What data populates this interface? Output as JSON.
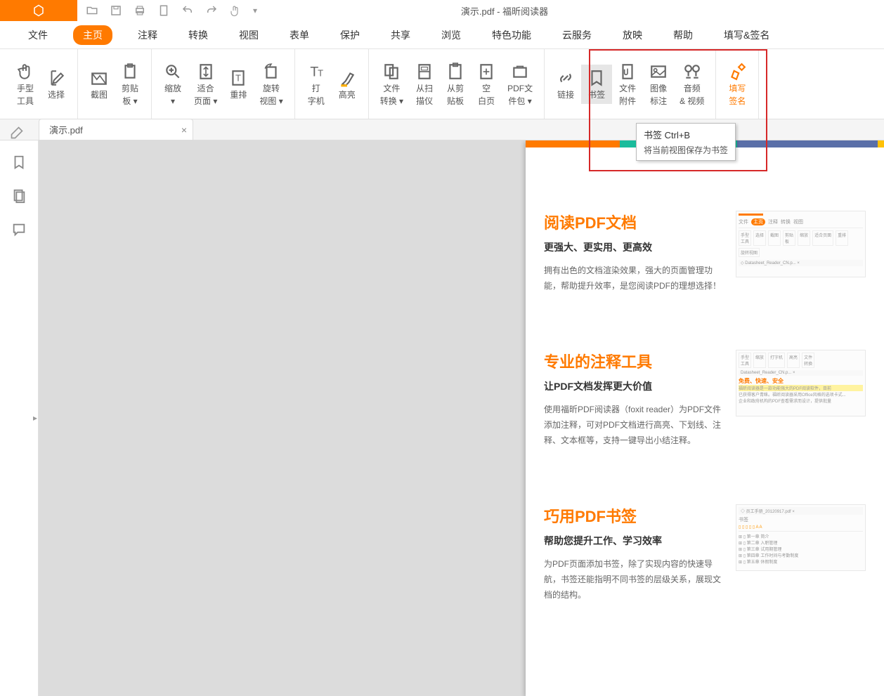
{
  "title": "演示.pdf - 福昕阅读器",
  "qat": {
    "logo": "foxit-logo"
  },
  "menus": [
    "文件",
    "主页",
    "注释",
    "转换",
    "视图",
    "表单",
    "保护",
    "共享",
    "浏览",
    "特色功能",
    "云服务",
    "放映",
    "帮助",
    "填写&签名"
  ],
  "active_menu": 1,
  "ribbon": {
    "groups": [
      [
        {
          "label": "手型\n工具",
          "icon": "hand"
        },
        {
          "label": "选择",
          "icon": "select-text"
        }
      ],
      [
        {
          "label": "截图",
          "icon": "snapshot"
        },
        {
          "label": "剪贴\n板 ▾",
          "icon": "clipboard"
        }
      ],
      [
        {
          "label": "缩放\n▾",
          "icon": "zoom"
        },
        {
          "label": "适合\n页面 ▾",
          "icon": "fit-page"
        },
        {
          "label": "重排",
          "icon": "reflow"
        },
        {
          "label": "旋转\n视图 ▾",
          "icon": "rotate"
        }
      ],
      [
        {
          "label": "打\n字机",
          "icon": "typewriter"
        },
        {
          "label": "高亮",
          "icon": "highlight"
        }
      ],
      [
        {
          "label": "文件\n转换 ▾",
          "icon": "file-convert"
        },
        {
          "label": "从扫\n描仪",
          "icon": "scanner"
        },
        {
          "label": "从剪\n贴板",
          "icon": "from-clip"
        },
        {
          "label": "空\n白页",
          "icon": "blank"
        },
        {
          "label": "PDF文\n件包 ▾",
          "icon": "portfolio"
        }
      ],
      [
        {
          "label": "链接",
          "icon": "link"
        },
        {
          "label": "书签",
          "icon": "bookmark",
          "hl": true
        },
        {
          "label": "文件\n附件",
          "icon": "attachment"
        },
        {
          "label": "图像\n标注",
          "icon": "image-anno"
        },
        {
          "label": "音频\n& 视频",
          "icon": "av"
        }
      ],
      [
        {
          "label": "填写\n签名",
          "icon": "fill-sign",
          "accent": true
        }
      ]
    ]
  },
  "tooltip": {
    "title": "书签     Ctrl+B",
    "body": "将当前视图保存为书签"
  },
  "tab": {
    "name": "演示.pdf"
  },
  "left_icons": [
    "bookmark-panel",
    "pages-panel",
    "comments-panel"
  ],
  "pdf": {
    "sections": [
      {
        "title": "阅读PDF文档",
        "sub": "更强大、更实用、更高效",
        "body": "拥有出色的文档渲染效果，强大的页面管理功能，帮助提升效率，是您阅读PDF的理想选择！",
        "thumb": "thumb-read"
      },
      {
        "title": "专业的注释工具",
        "sub": "让PDF文档发挥更大价值",
        "body": "使用福昕PDF阅读器（foxit reader）为PDF文件添加注释，可对PDF文档进行高亮、下划线、注释、文本框等，支持一键导出小结注释。",
        "thumb": "thumb-annotate"
      },
      {
        "title": "巧用PDF书签",
        "sub": "帮助您提升工作、学习效率",
        "body": "为PDF页面添加书签，除了实现内容的快速导航，书签还能指明不同书签的层级关系，展现文档的结构。",
        "thumb": "thumb-bookmark"
      }
    ],
    "thumb1": {
      "tab": "Datasheet_Reader_CN.p...",
      "menus": [
        "文件",
        "主页",
        "注释",
        "转换",
        "视图"
      ],
      "btns": [
        "手型\n工具",
        "选择",
        "截图",
        "剪贴\n板",
        "缩放",
        "适合页面",
        "重排",
        "旋转视图"
      ]
    },
    "thumb2": {
      "tab": "Datasheet_Reader_CN.p...",
      "headline": "免费、快速、安全",
      "line1": "福昕阅读器是一款功能强大的PDF阅读软件，目前",
      "line2": "已获得客户青睐。福昕阅读器采用Office风格的选项卡式...",
      "line3": "企业和政府机构的PDF查看需求而设计，提供批量",
      "btns": [
        "手型\n工具",
        "缩放",
        "打字机",
        "高亮",
        "文件\n转换"
      ]
    },
    "thumb3": {
      "tab": "员工手册_20120917.pdf",
      "panel": "书签",
      "items": [
        "第一章  简介",
        "第二章  入职管理",
        "第三章  试用期管理",
        "第四章  工作时间与考勤制度",
        "第五章  休假制度"
      ]
    }
  }
}
